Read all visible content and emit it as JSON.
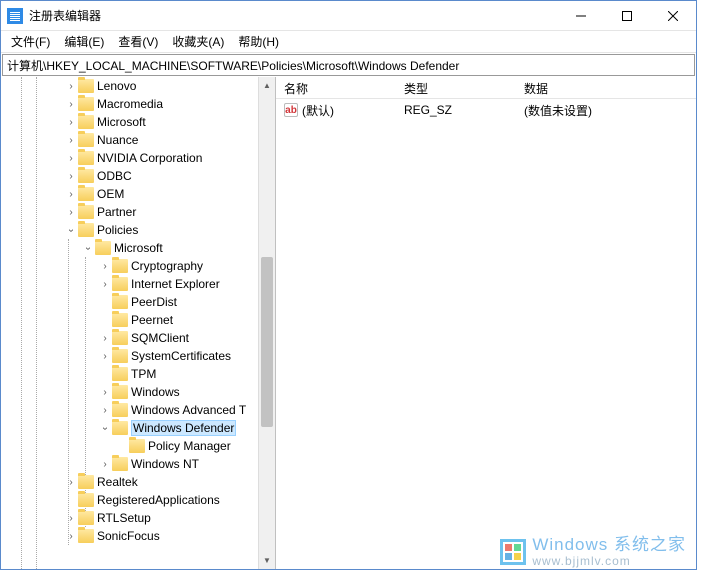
{
  "window": {
    "title": "注册表编辑器"
  },
  "menu": {
    "file": "文件(F)",
    "edit": "编辑(E)",
    "view": "查看(V)",
    "fav": "收藏夹(A)",
    "help": "帮助(H)"
  },
  "address": "计算机\\HKEY_LOCAL_MACHINE\\SOFTWARE\\Policies\\Microsoft\\Windows Defender",
  "tree": {
    "i0": "Lenovo",
    "i1": "Macromedia",
    "i2": "Microsoft",
    "i3": "Nuance",
    "i4": "NVIDIA Corporation",
    "i5": "ODBC",
    "i6": "OEM",
    "i7": "Partner",
    "i8": "Policies",
    "i9": "Microsoft",
    "i10": "Cryptography",
    "i11": "Internet Explorer",
    "i12": "PeerDist",
    "i13": "Peernet",
    "i14": "SQMClient",
    "i15": "SystemCertificates",
    "i16": "TPM",
    "i17": "Windows",
    "i18": "Windows Advanced T",
    "i19": "Windows Defender",
    "i20": "Policy Manager",
    "i21": "Windows NT",
    "i22": "Realtek",
    "i23": "RegisteredApplications",
    "i24": "RTLSetup",
    "i25": "SonicFocus"
  },
  "list": {
    "columns": {
      "name": "名称",
      "type": "类型",
      "data": "数据"
    },
    "rows": [
      {
        "name": "(默认)",
        "type": "REG_SZ",
        "data": "(数值未设置)"
      }
    ]
  },
  "watermark": {
    "brand": "Windows 系统之家",
    "url": "www.bjjmlv.com"
  }
}
